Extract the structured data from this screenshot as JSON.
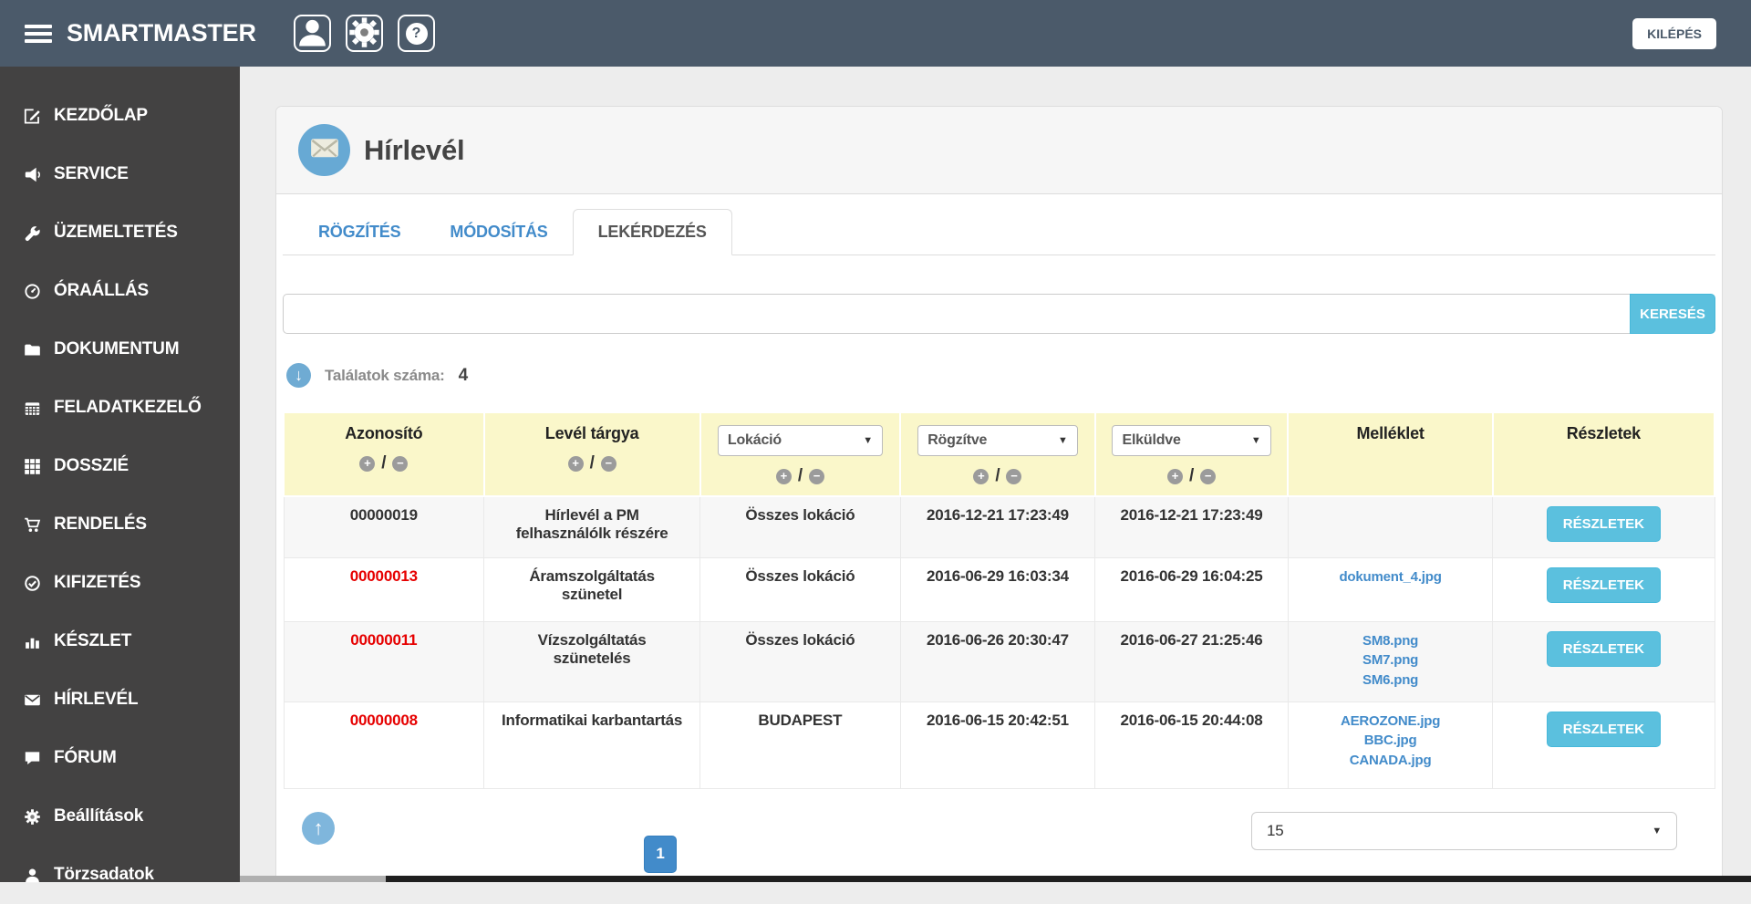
{
  "header": {
    "app_title": "SMARTMASTER",
    "logout_label": "KILÉPÉS"
  },
  "sidebar": {
    "items": [
      {
        "label": "KEZDŐLAP",
        "icon": "edit"
      },
      {
        "label": "SERVICE",
        "icon": "megaphone"
      },
      {
        "label": "ÜZEMELTETÉS",
        "icon": "wrench"
      },
      {
        "label": "ÓRAÁLLÁS",
        "icon": "gauge"
      },
      {
        "label": "DOKUMENTUM",
        "icon": "folder"
      },
      {
        "label": "FELADATKEZELŐ",
        "icon": "calendar"
      },
      {
        "label": "DOSSZIÉ",
        "icon": "grid"
      },
      {
        "label": "RENDELÉS",
        "icon": "cart"
      },
      {
        "label": "KIFIZETÉS",
        "icon": "check-circle"
      },
      {
        "label": "KÉSZLET",
        "icon": "bar-chart"
      },
      {
        "label": "HÍRLEVÉL",
        "icon": "envelope"
      },
      {
        "label": "FÓRUM",
        "icon": "comment"
      },
      {
        "label": "Beállítások",
        "icon": "gear"
      },
      {
        "label": "Törzsadatok",
        "icon": "user"
      }
    ]
  },
  "page": {
    "title": "Hírlevél",
    "tabs": [
      {
        "label": "RÖGZÍTÉS",
        "active": false
      },
      {
        "label": "MÓDOSÍTÁS",
        "active": false
      },
      {
        "label": "LEKÉRDEZÉS",
        "active": true
      }
    ],
    "search": {
      "value": "",
      "button_label": "KERESÉS"
    },
    "results": {
      "label": "Találatok száma:",
      "count": "4"
    }
  },
  "table": {
    "columns": [
      {
        "label": "Azonosító",
        "sort": true
      },
      {
        "label": "Levél tárgya",
        "sort": true
      },
      {
        "label": "Lokáció",
        "sort": true,
        "filter_dropdown": true
      },
      {
        "label": "Rögzítve",
        "sort": true,
        "filter_dropdown": true
      },
      {
        "label": "Elküldve",
        "sort": true,
        "filter_dropdown": true
      },
      {
        "label": "Melléklet"
      },
      {
        "label": "Részletek"
      }
    ],
    "details_button_label": "RÉSZLETEK",
    "rows": [
      {
        "id": "00000019",
        "id_highlight": false,
        "subject": "Hírlevél a PM felhasználólk részére",
        "location": "Összes lokáció",
        "recorded": "2016-12-21 17:23:49",
        "sent": "2016-12-21 17:23:49",
        "attachments": []
      },
      {
        "id": "00000013",
        "id_highlight": true,
        "subject": "Áramszolgáltatás szünetel",
        "location": "Összes lokáció",
        "recorded": "2016-06-29 16:03:34",
        "sent": "2016-06-29 16:04:25",
        "attachments": [
          "dokument_4.jpg"
        ]
      },
      {
        "id": "00000011",
        "id_highlight": true,
        "subject": "Vízszolgáltatás szünetelés",
        "location": "Összes lokáció",
        "recorded": "2016-06-26 20:30:47",
        "sent": "2016-06-27 21:25:46",
        "attachments": [
          "SM8.png",
          "SM7.png",
          "SM6.png"
        ]
      },
      {
        "id": "00000008",
        "id_highlight": true,
        "subject": "Informatikai karbantartás",
        "location": "BUDAPEST",
        "recorded": "2016-06-15 20:42:51",
        "sent": "2016-06-15 20:44:08",
        "attachments": [
          "AEROZONE.jpg",
          "BBC.jpg",
          "CANADA.jpg"
        ]
      }
    ]
  },
  "footer": {
    "current_page": "1",
    "page_size": "15"
  },
  "colors": {
    "topbar": "#4b5a6a",
    "sidebar": "#434242",
    "accent_blue": "#428bca",
    "info_blue": "#5bc0de",
    "table_header_bg": "#faf7ca",
    "alert_red": "#e60000",
    "icon_circle_blue": "#67a9d4"
  }
}
